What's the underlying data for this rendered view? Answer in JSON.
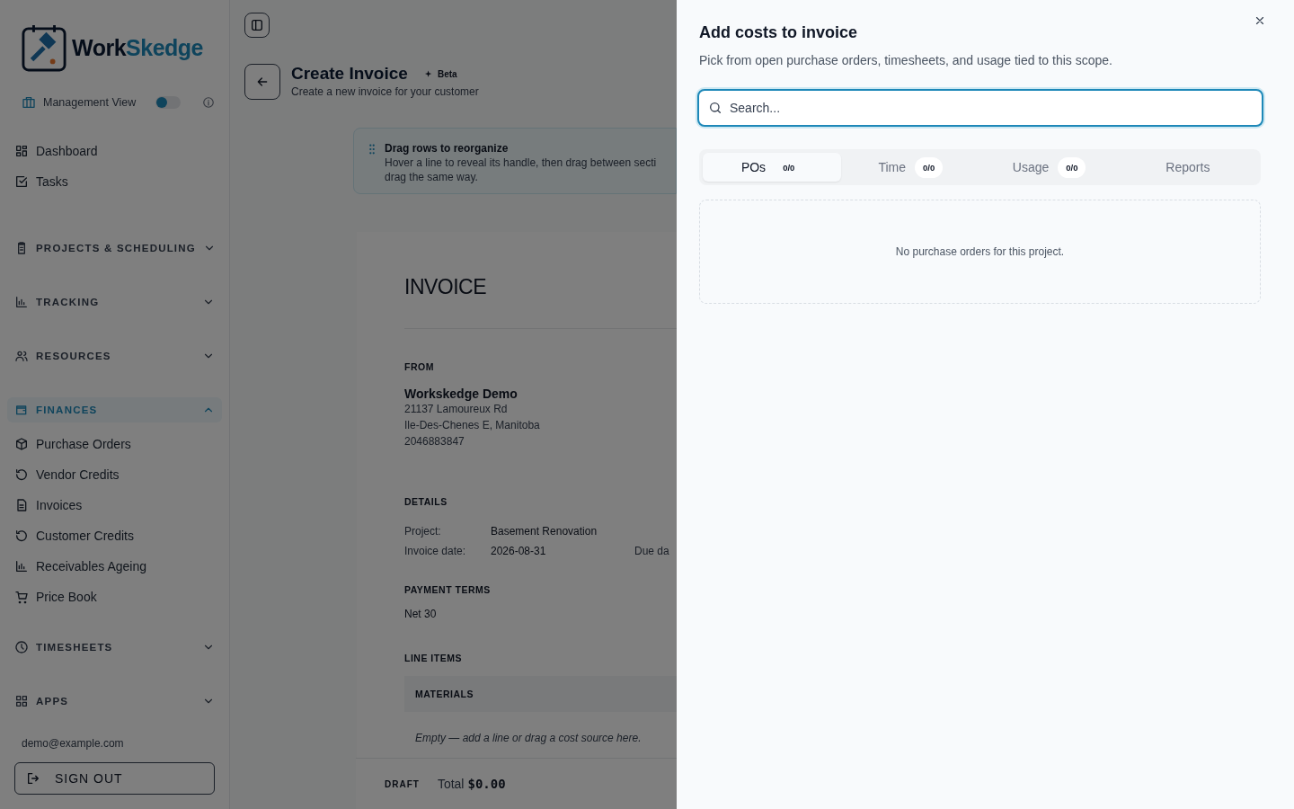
{
  "sidebar": {
    "logo": {
      "part_1": "Work",
      "part_2": "Skedge"
    },
    "management_view": {
      "label": "Management View",
      "on": false
    },
    "top_items": [
      {
        "label": "Dashboard"
      },
      {
        "label": "Tasks"
      }
    ],
    "sections": [
      {
        "label": "PROJECTS & SCHEDULING",
        "expanded": false,
        "selected": false
      },
      {
        "label": "TRACKING",
        "expanded": false,
        "selected": false
      },
      {
        "label": "RESOURCES",
        "expanded": false,
        "selected": false
      },
      {
        "label": "FINANCES",
        "expanded": true,
        "selected": true,
        "children": [
          {
            "label": "Purchase Orders"
          },
          {
            "label": "Vendor Credits"
          },
          {
            "label": "Invoices"
          },
          {
            "label": "Customer Credits"
          },
          {
            "label": "Receivables Ageing"
          },
          {
            "label": "Price Book"
          }
        ]
      },
      {
        "label": "TIMESHEETS",
        "expanded": false,
        "selected": false
      },
      {
        "label": "APPS",
        "expanded": false,
        "selected": false
      }
    ],
    "email": "demo@example.com",
    "sign_out": "SIGN OUT"
  },
  "header": {
    "title": "Create Invoice",
    "badge": "Beta",
    "subtitle": "Create a new invoice for your customer"
  },
  "hint": {
    "title": "Drag rows to reorganize",
    "lines": [
      "Hover a line to reveal its handle, then drag between secti",
      "drag the same way."
    ]
  },
  "invoice": {
    "heading": "INVOICE",
    "from_label": "FROM",
    "company": "Workskedge Demo",
    "address": [
      "21137 Lamoureux Rd",
      "Ile-Des-Chenes E, Manitoba",
      "2046883847"
    ],
    "details_label": "DETAILS",
    "details": [
      {
        "label": "Project:",
        "value": "Basement Renovation"
      },
      {
        "label": "Invoice date:",
        "value": "2026-08-31",
        "extra": "Due da"
      }
    ],
    "terms_label": "PAYMENT TERMS",
    "terms": "Net 30",
    "line_items_label": "LINE ITEMS",
    "group": "MATERIALS",
    "empty": "Empty — add a line or drag a cost source here."
  },
  "footer": {
    "status": "DRAFT",
    "total_label": "Total",
    "total": "$0.00"
  },
  "drawer": {
    "title": "Add costs to invoice",
    "subtitle": "Pick from open purchase orders, timesheets, and usage tied to this scope.",
    "search": {
      "placeholder": "Search..."
    },
    "tabs": [
      {
        "label": "POs",
        "count": "0/0",
        "selected": true
      },
      {
        "label": "Time",
        "count": "0/0",
        "selected": false
      },
      {
        "label": "Usage",
        "count": "0/0",
        "selected": false
      },
      {
        "label": "Reports",
        "selected": false
      }
    ],
    "empty": "No purchase orders for this project."
  }
}
